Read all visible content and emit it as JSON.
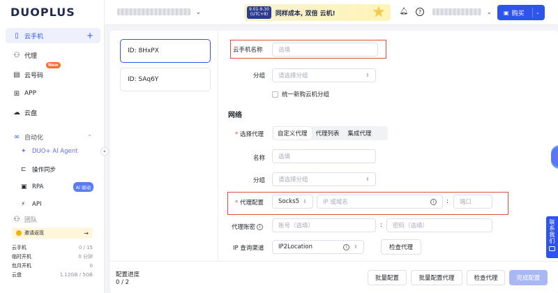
{
  "app": {
    "logo": "DUOPLUS"
  },
  "sidebar": {
    "items": [
      {
        "label": "云手机",
        "icon": "phone-icon"
      },
      {
        "label": "代理",
        "icon": "network-icon"
      },
      {
        "label": "云号码",
        "icon": "sim-icon",
        "badge": "New"
      },
      {
        "label": "APP",
        "icon": "apps-grid-icon"
      },
      {
        "label": "云盘",
        "icon": "cloud-icon"
      },
      {
        "label": "自动化",
        "icon": "infinity-icon"
      },
      {
        "label": "DUO+ AI Agent",
        "icon": "ai-agent-icon"
      },
      {
        "label": "操作同步",
        "icon": "sync-icon"
      },
      {
        "label": "RPA",
        "icon": "rpa-icon",
        "tag": "AI 驱动"
      },
      {
        "label": "API",
        "icon": "api-icon"
      },
      {
        "label": "团队",
        "icon": "team-icon"
      }
    ],
    "add_symbol": "+",
    "invite": {
      "label": "邀请返现",
      "arrow": "→"
    },
    "stats": [
      {
        "label": "云手机",
        "value": "0 / 15"
      },
      {
        "label": "临时开机",
        "value": "0 分钟"
      },
      {
        "label": "包月开机",
        "value": "0"
      },
      {
        "label": "云盘",
        "value": "1.12GB / 5GB"
      }
    ]
  },
  "topbar": {
    "promo": {
      "date_line1": "9.01-9.30",
      "date_line2": "(UTC+8)",
      "text": "同样成本, 双倍 云机!"
    },
    "buy_label": "购买"
  },
  "devices": [
    {
      "id_label": "ID: 8HxPX"
    },
    {
      "id_label": "ID: SAq6Y"
    }
  ],
  "form": {
    "name_label": "云手机名称",
    "name_placeholder": "选填",
    "group_label": "分组",
    "group_placeholder": "请选择分组",
    "checkbox_label": "统一新购云机分组",
    "network_heading": "网络",
    "proxy_select_label": "选择代理",
    "proxy_tabs": [
      "自定义代理",
      "代理列表",
      "集成代理"
    ],
    "proxy_name_label": "名称",
    "proxy_name_placeholder": "选填",
    "proxy_group_label": "分组",
    "proxy_group_placeholder": "请选择分组",
    "proxy_config_label": "代理配置",
    "proxy_type": "Socks5",
    "ip_placeholder": "IP 或域名",
    "port_placeholder": "端口",
    "account_label": "代理账密",
    "account_placeholder": "账号（选填）",
    "password_placeholder": "密码（选填）",
    "ip_query_label": "IP 查询渠道",
    "ip_query_value": "IP2Location",
    "check_proxy_label": "检查代理",
    "required_mark": "*",
    "colon": ":"
  },
  "footer": {
    "progress_label": "配置进度",
    "progress_value": "0 / 2",
    "buttons": [
      "批量配置",
      "批量配置代理",
      "检查代理",
      "完成配置"
    ]
  },
  "contact": {
    "label": "联系我们"
  },
  "colors": {
    "accent": "#2f54eb",
    "highlight_box": "#e04b3c",
    "badge_new": "#ff6b2c"
  }
}
